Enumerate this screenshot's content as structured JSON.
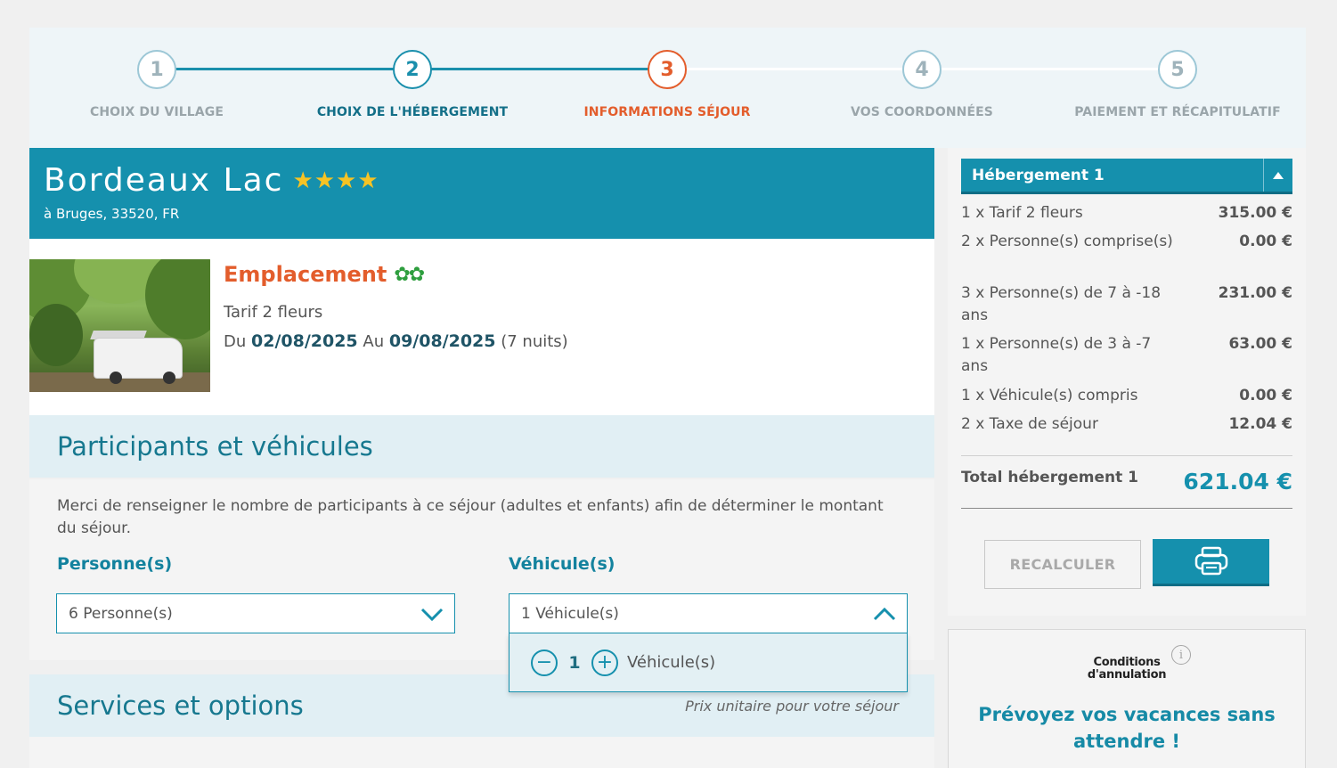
{
  "stepper": {
    "steps": [
      {
        "num": "1",
        "label": "CHOIX DU VILLAGE"
      },
      {
        "num": "2",
        "label": "CHOIX DE L'HÉBERGEMENT"
      },
      {
        "num": "3",
        "label": "INFORMATIONS SÉJOUR"
      },
      {
        "num": "4",
        "label": "VOS COORDONNÉES"
      },
      {
        "num": "5",
        "label": "PAIEMENT ET RÉCAPITULATIF"
      }
    ],
    "current_step": 3
  },
  "camping": {
    "name": "Bordeaux Lac",
    "stars": "★★★★",
    "address": "à Bruges, 33520, FR"
  },
  "lodging": {
    "title": "Emplacement",
    "flowers": "✿✿",
    "tarif": "Tarif 2 fleurs",
    "du_label": "Du",
    "date_from": "02/08/2025",
    "au_label": "Au",
    "date_to": "09/08/2025",
    "nights": "(7 nuits)"
  },
  "participants": {
    "heading": "Participants et véhicules",
    "intro": "Merci de renseigner le nombre de participants à ce séjour (adultes et enfants) afin de déterminer le montant du séjour.",
    "persons_label": "Personne(s)",
    "persons_value": "6 Personne(s)",
    "vehicles_label": "Véhicule(s)",
    "vehicles_value": "1 Véhicule(s)",
    "vehicle_stepper": {
      "minus": "−",
      "qty": "1",
      "plus": "+",
      "unit": "Véhicule(s)"
    }
  },
  "services": {
    "heading": "Services et options",
    "unit_price_note": "Prix unitaire pour votre séjour"
  },
  "summary": {
    "accordion_title": "Hébergement 1",
    "lines": [
      {
        "label": "1 x Tarif 2 fleurs",
        "amount": "315.00 €"
      },
      {
        "label": "2 x Personne(s) comprise(s)",
        "amount": "0.00 €"
      },
      {
        "label": "3 x Personne(s) de 7 à -18 ans",
        "amount": "231.00 €"
      },
      {
        "label": "1 x Personne(s) de 3 à -7 ans",
        "amount": "63.00 €"
      },
      {
        "label": "1 x Véhicule(s) compris",
        "amount": "0.00 €"
      },
      {
        "label": "2 x Taxe de séjour",
        "amount": "12.04 €"
      }
    ],
    "total_label": "Total hébergement 1",
    "total_amount": "621.04 €",
    "recalc_label": "RECALCULER"
  },
  "cancellation": {
    "logo_line1": "Conditions",
    "logo_line2": "d'annulation",
    "info": "i",
    "text": "Prévoyez vos vacances sans attendre !"
  },
  "colors": {
    "brand": "#1590ad",
    "accent": "#e35d2c",
    "flowers": "#2e9e3e",
    "stars": "#f6c324"
  }
}
